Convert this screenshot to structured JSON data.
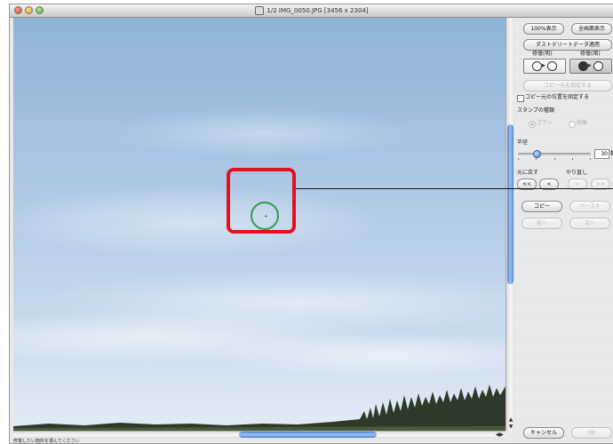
{
  "window": {
    "title": "1/2 IMG_0050.JPG  [3456 x 2304]"
  },
  "canvas": {
    "status_text": "修復したい箇所を選んでください",
    "brush_marker": "+"
  },
  "panel": {
    "view_100_label": "100%表示",
    "view_fit_label": "全画面表示",
    "apply_dust_delete_label": "ダストデリートデータ適用",
    "repair_light_label": "修復(明)",
    "repair_dark_label": "修復(暗)",
    "set_copy_source_label": "コピー元を指定する",
    "fix_copy_source_label": "コピー元の位置を固定する",
    "stamp_type_label": "スタンプの種類",
    "stamp_brush_label": "ブラシ",
    "stamp_pen_label": "鉛筆",
    "radius_label": "半径",
    "radius_value": "30",
    "radius_fraction": 0.25,
    "undo_header_label": "元に戻す",
    "redo_header_label": "やり直し",
    "undo_all_label": "<<",
    "undo_label": "<",
    "redo_label": ">",
    "redo_all_label": ">>",
    "copy_label": "コピー",
    "paste_label": "ペースト",
    "prev_label": "前へ",
    "next_label": "次へ",
    "cancel_label": "キャンセル",
    "ok_label": "OK"
  },
  "colors": {
    "highlight": "#e3101d",
    "brush": "#3a9a4a",
    "scroll_thumb": "#4f86d6"
  },
  "icons": {
    "scroll_up": "▲",
    "scroll_down": "▼",
    "scroll_left": "◀",
    "scroll_right": "▶",
    "stepper_up": "▲",
    "stepper_down": "▼"
  }
}
